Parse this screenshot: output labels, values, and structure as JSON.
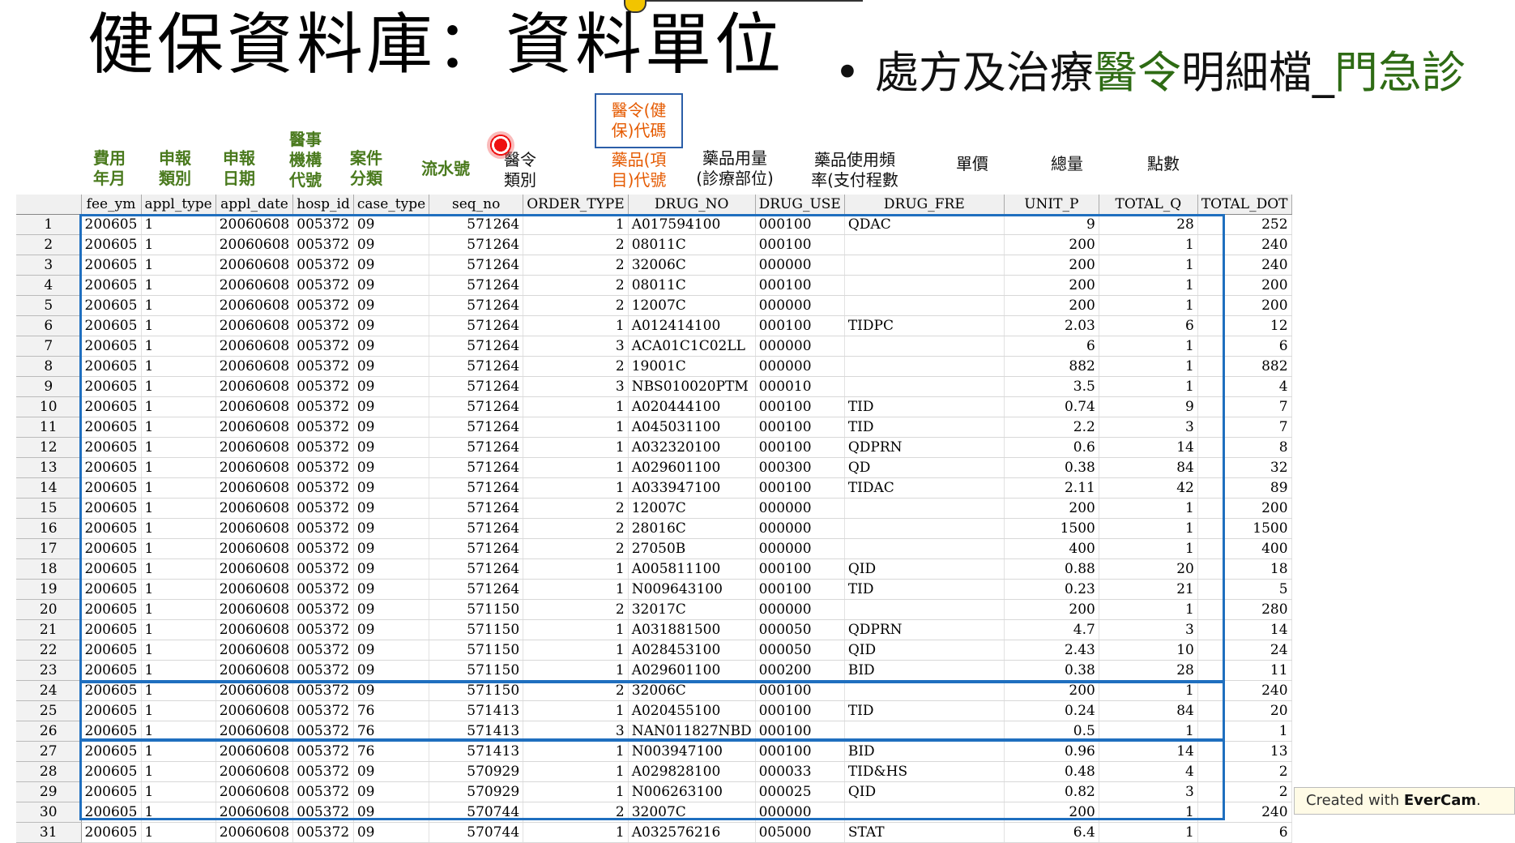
{
  "slide": {
    "title": "健保資料庫：資料單位",
    "subtitle_parts": {
      "bullet": "•",
      "a": "處方及治療",
      "b": "醫令",
      "c": "明細檔_",
      "d": "門急診"
    }
  },
  "chinese_headers": {
    "fee_ym": "費用\n年月",
    "appl_type": "申報\n類別",
    "appl_date": "申報\n日期",
    "hosp_id": "醫事\n機構\n代號",
    "case_type": "案件\n分類",
    "seq_no": "流水號",
    "order_type": "醫令\n類別",
    "drug_no_top": "醫令(健\n保)代碼",
    "drug_no": "藥品(項\n目)代號",
    "drug_use": "藥品用量\n(診療部位)",
    "drug_fre": "藥品使用頻\n率(支付程數",
    "unit_p": "單價",
    "total_q": "總量",
    "total_dot": "點數"
  },
  "columns": [
    "fee_ym",
    "appl_type",
    "appl_date",
    "hosp_id",
    "case_type",
    "seq_no",
    "ORDER_TYPE",
    "DRUG_NO",
    "DRUG_USE",
    "DRUG_FRE",
    "UNIT_P",
    "TOTAL_Q",
    "TOTAL_DOT"
  ],
  "rows": [
    [
      "1",
      "200605",
      "1",
      "20060608",
      "005372",
      "09",
      "571264",
      "1",
      "A017594100",
      "000100",
      "QDAC",
      "9",
      "28",
      "252"
    ],
    [
      "2",
      "200605",
      "1",
      "20060608",
      "005372",
      "09",
      "571264",
      "2",
      "08011C",
      "000100",
      "",
      "200",
      "1",
      "240"
    ],
    [
      "3",
      "200605",
      "1",
      "20060608",
      "005372",
      "09",
      "571264",
      "2",
      "32006C",
      "000000",
      "",
      "200",
      "1",
      "240"
    ],
    [
      "4",
      "200605",
      "1",
      "20060608",
      "005372",
      "09",
      "571264",
      "2",
      "08011C",
      "000100",
      "",
      "200",
      "1",
      "200"
    ],
    [
      "5",
      "200605",
      "1",
      "20060608",
      "005372",
      "09",
      "571264",
      "2",
      "12007C",
      "000000",
      "",
      "200",
      "1",
      "200"
    ],
    [
      "6",
      "200605",
      "1",
      "20060608",
      "005372",
      "09",
      "571264",
      "1",
      "A012414100",
      "000100",
      "TIDPC",
      "2.03",
      "6",
      "12"
    ],
    [
      "7",
      "200605",
      "1",
      "20060608",
      "005372",
      "09",
      "571264",
      "3",
      "ACA01C1C02LL",
      "000000",
      "",
      "6",
      "1",
      "6"
    ],
    [
      "8",
      "200605",
      "1",
      "20060608",
      "005372",
      "09",
      "571264",
      "2",
      "19001C",
      "000000",
      "",
      "882",
      "1",
      "882"
    ],
    [
      "9",
      "200605",
      "1",
      "20060608",
      "005372",
      "09",
      "571264",
      "3",
      "NBS010020PTM",
      "000010",
      "",
      "3.5",
      "1",
      "4"
    ],
    [
      "10",
      "200605",
      "1",
      "20060608",
      "005372",
      "09",
      "571264",
      "1",
      "A020444100",
      "000100",
      "TID",
      "0.74",
      "9",
      "7"
    ],
    [
      "11",
      "200605",
      "1",
      "20060608",
      "005372",
      "09",
      "571264",
      "1",
      "A045031100",
      "000100",
      "TID",
      "2.2",
      "3",
      "7"
    ],
    [
      "12",
      "200605",
      "1",
      "20060608",
      "005372",
      "09",
      "571264",
      "1",
      "A032320100",
      "000100",
      "QDPRN",
      "0.6",
      "14",
      "8"
    ],
    [
      "13",
      "200605",
      "1",
      "20060608",
      "005372",
      "09",
      "571264",
      "1",
      "A029601100",
      "000300",
      "QD",
      "0.38",
      "84",
      "32"
    ],
    [
      "14",
      "200605",
      "1",
      "20060608",
      "005372",
      "09",
      "571264",
      "1",
      "A033947100",
      "000100",
      "TIDAC",
      "2.11",
      "42",
      "89"
    ],
    [
      "15",
      "200605",
      "1",
      "20060608",
      "005372",
      "09",
      "571264",
      "2",
      "12007C",
      "000000",
      "",
      "200",
      "1",
      "200"
    ],
    [
      "16",
      "200605",
      "1",
      "20060608",
      "005372",
      "09",
      "571264",
      "2",
      "28016C",
      "000000",
      "",
      "1500",
      "1",
      "1500"
    ],
    [
      "17",
      "200605",
      "1",
      "20060608",
      "005372",
      "09",
      "571264",
      "2",
      "27050B",
      "000000",
      "",
      "400",
      "1",
      "400"
    ],
    [
      "18",
      "200605",
      "1",
      "20060608",
      "005372",
      "09",
      "571264",
      "1",
      "A005811100",
      "000100",
      "QID",
      "0.88",
      "20",
      "18"
    ],
    [
      "19",
      "200605",
      "1",
      "20060608",
      "005372",
      "09",
      "571264",
      "1",
      "N009643100",
      "000100",
      "TID",
      "0.23",
      "21",
      "5"
    ],
    [
      "20",
      "200605",
      "1",
      "20060608",
      "005372",
      "09",
      "571150",
      "2",
      "32017C",
      "000000",
      "",
      "200",
      "1",
      "280"
    ],
    [
      "21",
      "200605",
      "1",
      "20060608",
      "005372",
      "09",
      "571150",
      "1",
      "A031881500",
      "000050",
      "QDPRN",
      "4.7",
      "3",
      "14"
    ],
    [
      "22",
      "200605",
      "1",
      "20060608",
      "005372",
      "09",
      "571150",
      "1",
      "A028453100",
      "000050",
      "QID",
      "2.43",
      "10",
      "24"
    ],
    [
      "23",
      "200605",
      "1",
      "20060608",
      "005372",
      "09",
      "571150",
      "1",
      "A029601100",
      "000200",
      "BID",
      "0.38",
      "28",
      "11"
    ],
    [
      "24",
      "200605",
      "1",
      "20060608",
      "005372",
      "09",
      "571150",
      "2",
      "32006C",
      "000100",
      "",
      "200",
      "1",
      "240"
    ],
    [
      "25",
      "200605",
      "1",
      "20060608",
      "005372",
      "76",
      "571413",
      "1",
      "A020455100",
      "000100",
      "TID",
      "0.24",
      "84",
      "20"
    ],
    [
      "26",
      "200605",
      "1",
      "20060608",
      "005372",
      "76",
      "571413",
      "3",
      "NAN011827NBD",
      "000100",
      "",
      "0.5",
      "1",
      "1"
    ],
    [
      "27",
      "200605",
      "1",
      "20060608",
      "005372",
      "76",
      "571413",
      "1",
      "N003947100",
      "000100",
      "BID",
      "0.96",
      "14",
      "13"
    ],
    [
      "28",
      "200605",
      "1",
      "20060608",
      "005372",
      "09",
      "570929",
      "1",
      "A029828100",
      "000033",
      "TID&HS",
      "0.48",
      "4",
      "2"
    ],
    [
      "29",
      "200605",
      "1",
      "20060608",
      "005372",
      "09",
      "570929",
      "1",
      "N006263100",
      "000025",
      "QID",
      "0.82",
      "3",
      "2"
    ],
    [
      "30",
      "200605",
      "1",
      "20060608",
      "005372",
      "09",
      "570744",
      "2",
      "32007C",
      "000000",
      "",
      "200",
      "1",
      "240"
    ],
    [
      "31",
      "200605",
      "1",
      "20060608",
      "005372",
      "09",
      "570744",
      "1",
      "A032576216",
      "005000",
      "STAT",
      "6.4",
      "1",
      "6"
    ]
  ],
  "watermark": {
    "prefix": "Created with ",
    "brand": "EverCam",
    "suffix": "."
  },
  "colors": {
    "green_header": "#4a7a1e",
    "orange_header": "#e55a00",
    "group_box": "#1f6fbf",
    "subtitle_green": "#2e6b14"
  }
}
